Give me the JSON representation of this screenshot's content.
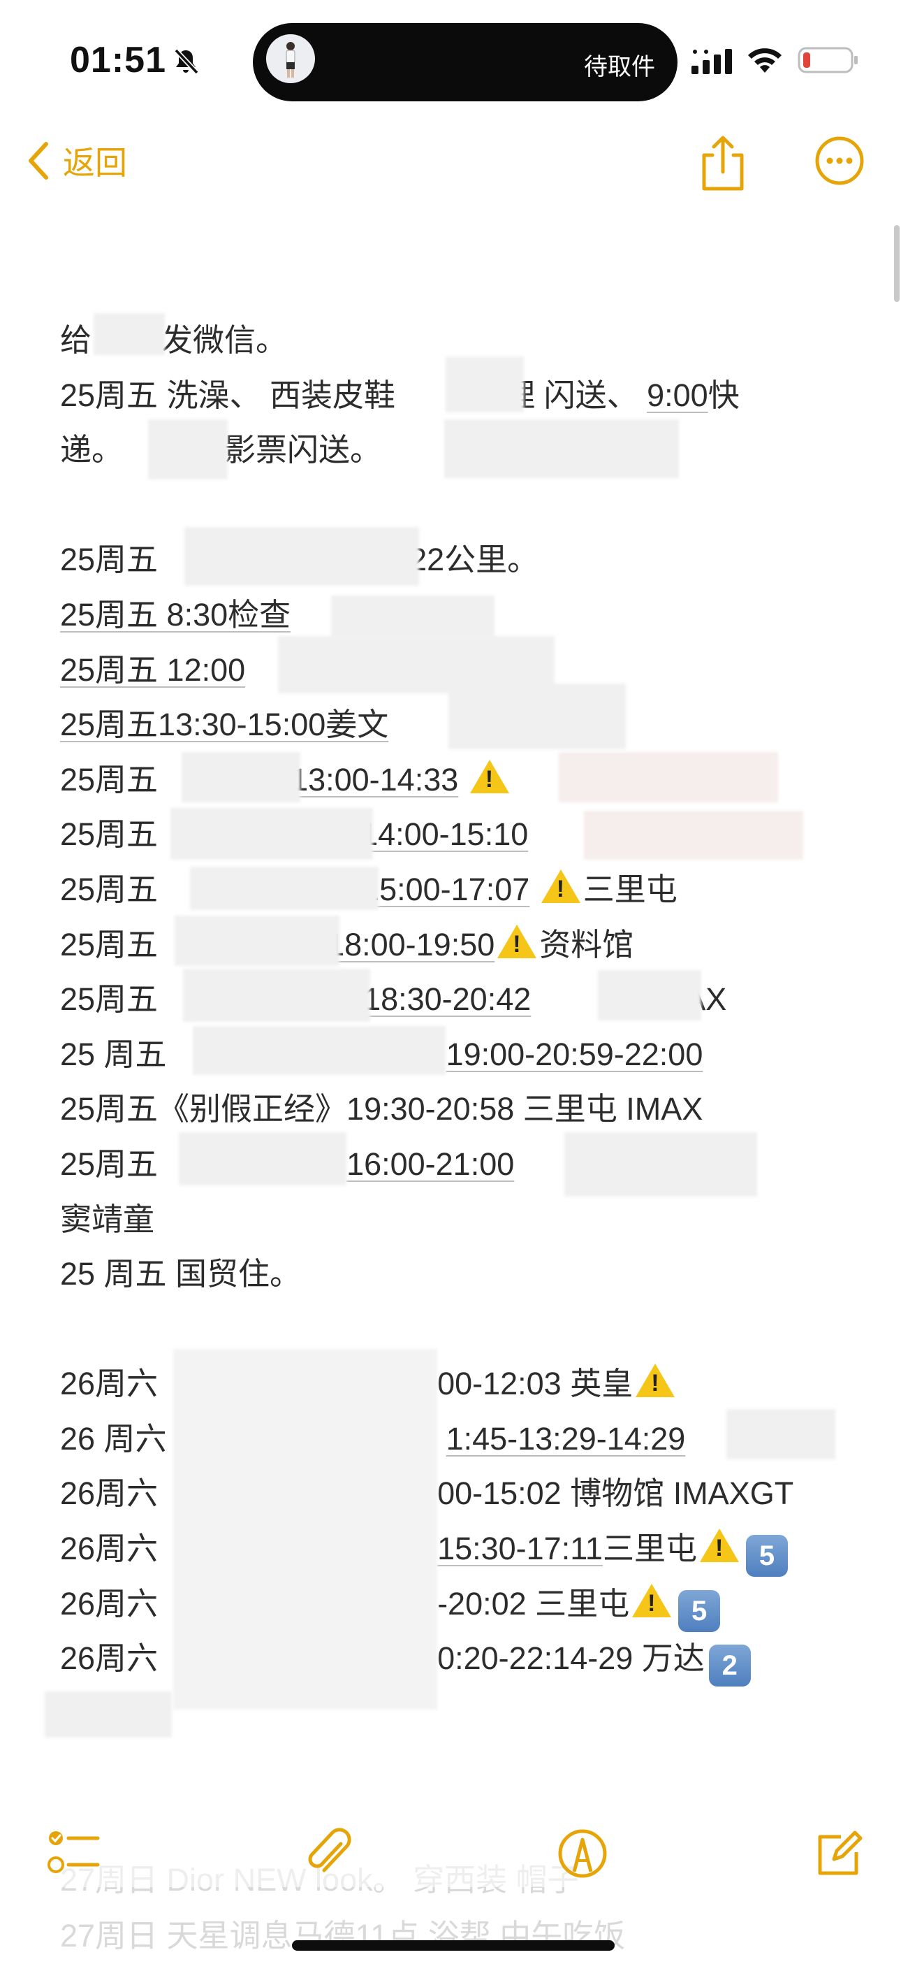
{
  "status": {
    "time": "01:51",
    "island_label": "待取件"
  },
  "nav": {
    "back_label": "返回"
  },
  "note": {
    "lines": [
      "给",
      "发微信。",
      "25周五 洗澡、 西装皮鞋",
      "整理 闪送、",
      "9:00",
      "快",
      "递。",
      "电影票闪送。",
      "。",
      "25周五",
      "22公里。",
      "25周五 8:30检查",
      "25周五 12:00",
      "25周五13:30-15:00姜文",
      "13:00-14:33",
      "14:00-15:10",
      "15:00-17:07",
      "三里屯",
      "18:00-19:50",
      "资料馆",
      "18:30-20:42",
      "IMAX",
      "25 周五",
      "19:00-20:59-22:00",
      "25周五《别假正经》19:30-20:58 三里屯 IMAX",
      "16:00-21:00",
      "窦靖童",
      "25 周五 国贸住。",
      "26周六",
      "00-12:03 英皇",
      "26 周六",
      "1:45-13:29-14:29",
      "00-15:02 博物馆 IMAXGT",
      "15:30-17:11",
      "-20:02 三里屯",
      "0:20-22:14-29 万达",
      "5",
      "2"
    ]
  },
  "ghost": {
    "line1": "27周日 Dior NEW look。 穿西装 帽子",
    "line2": "27周日 天星调息马德11点 浴帮 中午吃饭"
  },
  "colors": {
    "accent": "#e5a508",
    "warning": "#f5c518",
    "keycap": "#5a86c4"
  },
  "icons": {
    "back": "chevron-left-icon",
    "share": "share-icon",
    "more": "ellipsis-circle-icon",
    "checklist": "checklist-icon",
    "attach": "paperclip-icon",
    "markup": "markup-pen-icon",
    "compose": "compose-icon"
  }
}
